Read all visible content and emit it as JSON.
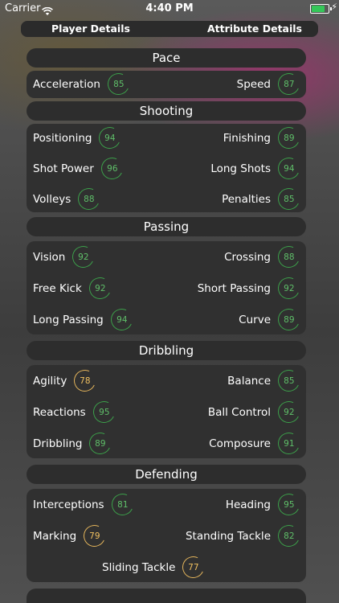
{
  "status_bar": {
    "carrier": "Carrier",
    "time": "4:40 PM"
  },
  "tabs": {
    "left": "Player Details",
    "right": "Attribute Details"
  },
  "colors": {
    "high": "#3ca04a",
    "medium": "#e3b45b",
    "card": "#303030"
  },
  "sections": {
    "pace": {
      "title": "Pace",
      "acceleration": {
        "label": "Acceleration",
        "value": "85"
      },
      "speed": {
        "label": "Speed",
        "value": "87"
      }
    },
    "shooting": {
      "title": "Shooting",
      "positioning": {
        "label": "Positioning",
        "value": "94"
      },
      "finishing": {
        "label": "Finishing",
        "value": "89"
      },
      "shot_power": {
        "label": "Shot Power",
        "value": "96"
      },
      "long_shots": {
        "label": "Long Shots",
        "value": "94"
      },
      "volleys": {
        "label": "Volleys",
        "value": "88"
      },
      "penalties": {
        "label": "Penalties",
        "value": "85"
      }
    },
    "passing": {
      "title": "Passing",
      "vision": {
        "label": "Vision",
        "value": "92"
      },
      "crossing": {
        "label": "Crossing",
        "value": "88"
      },
      "free_kick": {
        "label": "Free Kick",
        "value": "92"
      },
      "short_passing": {
        "label": "Short Passing",
        "value": "92"
      },
      "long_passing": {
        "label": "Long Passing",
        "value": "94"
      },
      "curve": {
        "label": "Curve",
        "value": "89"
      }
    },
    "dribbling": {
      "title": "Dribbling",
      "agility": {
        "label": "Agility",
        "value": "78"
      },
      "balance": {
        "label": "Balance",
        "value": "85"
      },
      "reactions": {
        "label": "Reactions",
        "value": "95"
      },
      "ball_control": {
        "label": "Ball Control",
        "value": "92"
      },
      "dribbling": {
        "label": "Dribbling",
        "value": "89"
      },
      "composure": {
        "label": "Composure",
        "value": "91"
      }
    },
    "defending": {
      "title": "Defending",
      "interceptions": {
        "label": "Interceptions",
        "value": "81"
      },
      "heading": {
        "label": "Heading",
        "value": "95"
      },
      "marking": {
        "label": "Marking",
        "value": "79"
      },
      "standing_tackle": {
        "label": "Standing Tackle",
        "value": "82"
      },
      "sliding_tackle": {
        "label": "Sliding Tackle",
        "value": "77"
      }
    }
  }
}
